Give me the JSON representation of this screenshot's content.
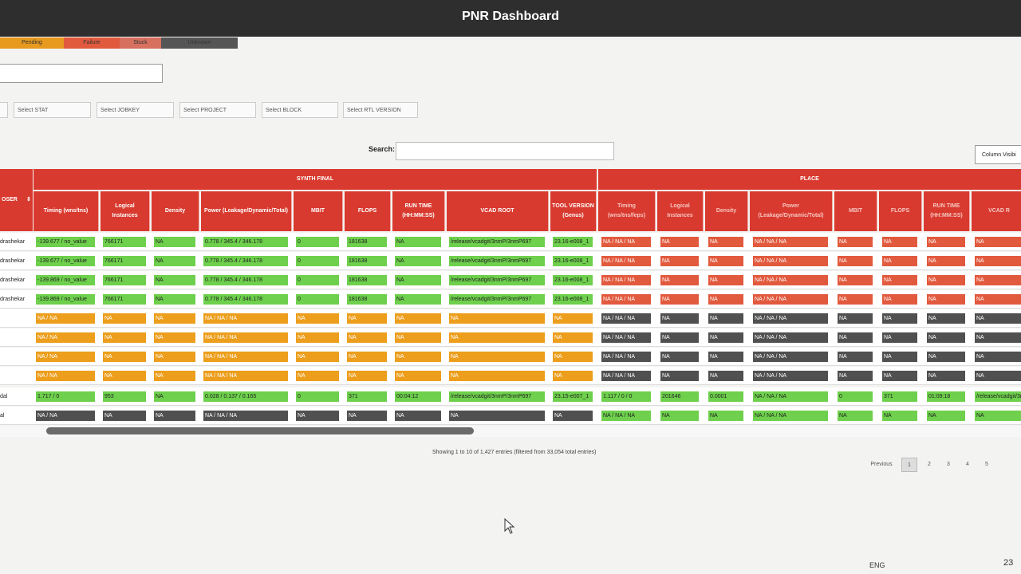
{
  "app": {
    "title": "PNR Dashboard"
  },
  "legend": [
    {
      "label": "Pending",
      "color": "#e79a1e"
    },
    {
      "label": "Failure",
      "color": "#e25a3e"
    },
    {
      "label": "Stuck",
      "color": "#d87060"
    },
    {
      "label": "Unknown",
      "color": "#555555"
    }
  ],
  "filters": [
    "Select STAT",
    "Select JOBKEY",
    "Select PROJECT",
    "Select BLOCK",
    "Select RTL VERSION"
  ],
  "search": {
    "label": "Search:",
    "value": ""
  },
  "column_visibility_label": "Column Visibi",
  "groups": {
    "user_header": "OSER",
    "synth_final": "SYNTH FINAL",
    "place": "PLACE"
  },
  "headers": {
    "synth": [
      "Timing (wns/tns)",
      "Logical Instances",
      "Density",
      "Power (Leakage/Dynamic/Total)",
      "MBIT",
      "FLOPS",
      "RUN TIME (HH:MM:SS)",
      "VCAD ROOT",
      "TOOL VERSION (Genus)"
    ],
    "place": [
      "Timing (wns/tns/feps)",
      "Logical Instances",
      "Density",
      "Power (Leakage/Dynamic/Total)",
      "MBIT",
      "FLOPS",
      "RUN TIME (HH:MM:SS)",
      "VCAD R"
    ]
  },
  "rows": [
    {
      "user": "drashekar",
      "synth": [
        "-139.677 / no_value",
        "766171",
        "NA",
        "0.778 / 345.4 / 346.178",
        "0",
        "181638",
        "NA",
        "/release/vcadgit/3nmP/3nmP697",
        "23.16-e008_1"
      ],
      "synth_colors": [
        "g",
        "g",
        "g",
        "g",
        "g",
        "g",
        "g",
        "g",
        "g"
      ],
      "place": [
        "NA / NA / NA",
        "NA",
        "NA",
        "NA / NA / NA",
        "NA",
        "NA",
        "NA",
        "NA"
      ],
      "place_colors": [
        "r",
        "r",
        "r",
        "r",
        "r",
        "r",
        "r",
        "r"
      ]
    },
    {
      "user": "drashekar",
      "synth": [
        "-139.677 / no_value",
        "766171",
        "NA",
        "0.778 / 345.4 / 346.178",
        "0",
        "181638",
        "NA",
        "/release/vcadgit/3nmP/3nmP697",
        "23.16-e008_1"
      ],
      "synth_colors": [
        "g",
        "g",
        "g",
        "g",
        "g",
        "g",
        "g",
        "g",
        "g"
      ],
      "place": [
        "NA / NA / NA",
        "NA",
        "NA",
        "NA / NA / NA",
        "NA",
        "NA",
        "NA",
        "NA"
      ],
      "place_colors": [
        "r",
        "r",
        "r",
        "r",
        "r",
        "r",
        "r",
        "r"
      ]
    },
    {
      "user": "drashekar",
      "synth": [
        "-139.869 / no_value",
        "766171",
        "NA",
        "0.778 / 345.4 / 346.178",
        "0",
        "181638",
        "NA",
        "/release/vcadgit/3nmP/3nmP697",
        "23.16-e008_1"
      ],
      "synth_colors": [
        "g",
        "g",
        "g",
        "g",
        "g",
        "g",
        "g",
        "g",
        "g"
      ],
      "place": [
        "NA / NA / NA",
        "NA",
        "NA",
        "NA / NA / NA",
        "NA",
        "NA",
        "NA",
        "NA"
      ],
      "place_colors": [
        "r",
        "r",
        "r",
        "r",
        "r",
        "r",
        "r",
        "r"
      ]
    },
    {
      "user": "drashekar",
      "synth": [
        "-139.869 / no_value",
        "766171",
        "NA",
        "0.778 / 345.4 / 346.178",
        "0",
        "181638",
        "NA",
        "/release/vcadgit/3nmP/3nmP697",
        "23.16-e008_1"
      ],
      "synth_colors": [
        "g",
        "g",
        "g",
        "g",
        "g",
        "g",
        "g",
        "g",
        "g"
      ],
      "place": [
        "NA / NA / NA",
        "NA",
        "NA",
        "NA / NA / NA",
        "NA",
        "NA",
        "NA",
        "NA"
      ],
      "place_colors": [
        "r",
        "r",
        "r",
        "r",
        "r",
        "r",
        "r",
        "r"
      ]
    },
    {
      "user": "",
      "synth": [
        "NA / NA",
        "NA",
        "NA",
        "NA / NA / NA",
        "NA",
        "NA",
        "NA",
        "NA",
        "NA"
      ],
      "synth_colors": [
        "o",
        "o",
        "o",
        "o",
        "o",
        "o",
        "o",
        "o",
        "o"
      ],
      "place": [
        "NA / NA / NA",
        "NA",
        "NA",
        "NA / NA / NA",
        "NA",
        "NA",
        "NA",
        "NA"
      ],
      "place_colors": [
        "d",
        "d",
        "d",
        "d",
        "d",
        "d",
        "d",
        "d"
      ]
    },
    {
      "user": "",
      "synth": [
        "NA / NA",
        "NA",
        "NA",
        "NA / NA / NA",
        "NA",
        "NA",
        "NA",
        "NA",
        "NA"
      ],
      "synth_colors": [
        "o",
        "o",
        "o",
        "o",
        "o",
        "o",
        "o",
        "o",
        "o"
      ],
      "place": [
        "NA / NA / NA",
        "NA",
        "NA",
        "NA / NA / NA",
        "NA",
        "NA",
        "NA",
        "NA"
      ],
      "place_colors": [
        "d",
        "d",
        "d",
        "d",
        "d",
        "d",
        "d",
        "d"
      ]
    },
    {
      "user": "",
      "synth": [
        "NA / NA",
        "NA",
        "NA",
        "NA / NA / NA",
        "NA",
        "NA",
        "NA",
        "NA",
        "NA"
      ],
      "synth_colors": [
        "o",
        "o",
        "o",
        "o",
        "o",
        "o",
        "o",
        "o",
        "o"
      ],
      "place": [
        "NA / NA / NA",
        "NA",
        "NA",
        "NA / NA / NA",
        "NA",
        "NA",
        "NA",
        "NA"
      ],
      "place_colors": [
        "d",
        "d",
        "d",
        "d",
        "d",
        "d",
        "d",
        "d"
      ]
    },
    {
      "user": "",
      "synth": [
        "NA / NA",
        "NA",
        "NA",
        "NA / NA / NA",
        "NA",
        "NA",
        "NA",
        "NA",
        "NA"
      ],
      "synth_colors": [
        "o",
        "o",
        "o",
        "o",
        "o",
        "o",
        "o",
        "o",
        "o"
      ],
      "place": [
        "NA / NA / NA",
        "NA",
        "NA",
        "NA / NA / NA",
        "NA",
        "NA",
        "NA",
        "NA"
      ],
      "place_colors": [
        "d",
        "d",
        "d",
        "d",
        "d",
        "d",
        "d",
        "d"
      ]
    },
    {
      "user": "dal",
      "synth": [
        "1.717 / 0",
        "953",
        "NA",
        "0.028 / 0.137 / 0.165",
        "0",
        "371",
        "00:04:12",
        "/release/vcadgit/3nmP/3nmP697",
        "23.15-e007_1"
      ],
      "synth_colors": [
        "g",
        "g",
        "g",
        "g",
        "g",
        "g",
        "g",
        "g",
        "g"
      ],
      "place": [
        "1.117 / 0 / 0",
        "201646",
        "0.0001",
        "NA / NA / NA",
        "0",
        "371",
        "01:09:18",
        "/release/vcadgit/3n"
      ],
      "place_colors": [
        "g",
        "g",
        "g",
        "g",
        "g",
        "g",
        "g",
        "g"
      ]
    },
    {
      "user": "al",
      "synth": [
        "NA / NA",
        "NA",
        "NA",
        "NA / NA / NA",
        "NA",
        "NA",
        "NA",
        "NA",
        "NA"
      ],
      "synth_colors": [
        "d",
        "d",
        "d",
        "d",
        "d",
        "d",
        "d",
        "d",
        "d"
      ],
      "place": [
        "NA / NA / NA",
        "NA",
        "NA",
        "NA / NA / NA",
        "NA",
        "NA",
        "NA",
        "NA"
      ],
      "place_colors": [
        "g",
        "g",
        "g",
        "g",
        "g",
        "g",
        "g",
        "g"
      ]
    }
  ],
  "footer": {
    "info": "Showing 1 to 10 of 1,427 entries (filtered from 33,054 total entries)",
    "previous": "Previous",
    "pages": [
      "1",
      "2",
      "3",
      "4",
      "5"
    ],
    "active_page": "1"
  },
  "taskbar": {
    "lang": "ENG",
    "clock": "23"
  }
}
